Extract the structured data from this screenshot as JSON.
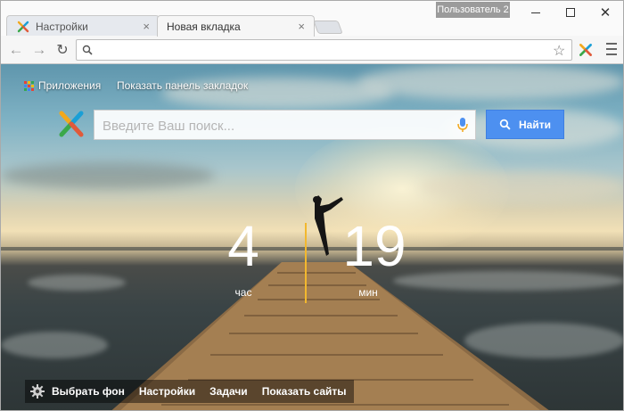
{
  "window": {
    "user_badge": "Пользователь 2",
    "controls": {
      "minimize": "minimize-icon",
      "maximize": "maximize-icon",
      "close": "close-icon"
    }
  },
  "tabs": [
    {
      "label": "Настройки",
      "active": false,
      "close": "×"
    },
    {
      "label": "Новая вкладка",
      "active": true,
      "close": "×"
    }
  ],
  "toolbar": {
    "back": "←",
    "forward": "→",
    "reload": "↻",
    "address_value": "",
    "star": "☆"
  },
  "page": {
    "apps_label": "Приложения",
    "bookmarks_label": "Показать панель закладок",
    "search": {
      "placeholder": "Введите Ваш поиск...",
      "button_label": "Найти"
    },
    "clock": {
      "hours": "4",
      "minutes": "19",
      "hours_label": "час",
      "minutes_label": "мин"
    },
    "bottom_bar": {
      "choose_background": "Выбрать фон",
      "settings": "Настройки",
      "tasks": "Задачи",
      "show_sites": "Показать сайты"
    },
    "accent_colors": {
      "search_button": "#4d90f0",
      "clock_divider": "#f2b82e"
    }
  }
}
